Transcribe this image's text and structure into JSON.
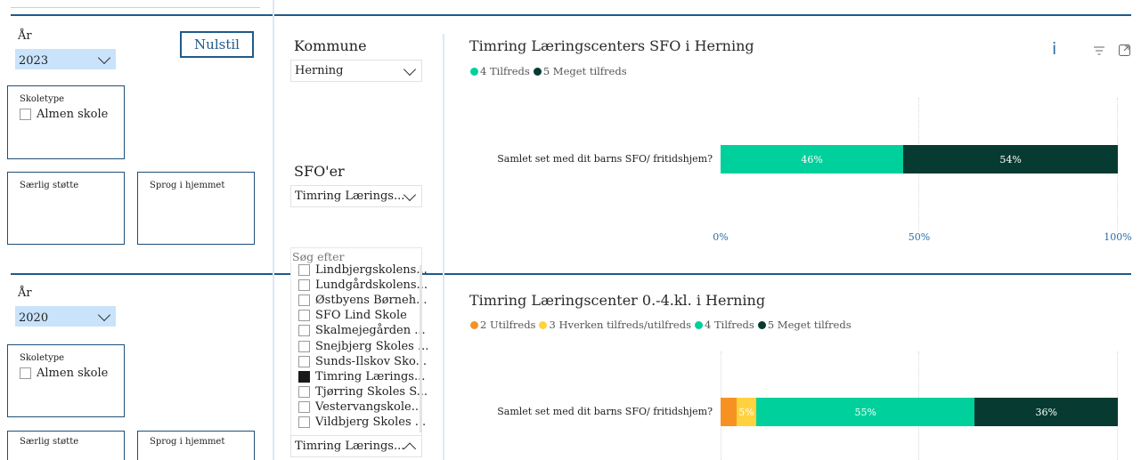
{
  "colors": {
    "accent": "#1f5a8a",
    "tilfreds": "#00d09b",
    "meget_tilfreds": "#073b32",
    "utilfreds": "#f79222",
    "hverken": "#ffd23f"
  },
  "top": {
    "year_label": "År",
    "year_value": "2023",
    "reset_label": "Nulstil",
    "school_type_title": "Skoletype",
    "school_type_option": "Almen skole",
    "special_support_title": "Særlig støtte",
    "home_language_title": "Sprog i hjemmet"
  },
  "bottom": {
    "year_label": "År",
    "year_value": "2020",
    "school_type_title": "Skoletype",
    "school_type_option": "Almen skole",
    "special_support_title": "Særlig støtte",
    "home_language_title": "Sprog i hjemmet"
  },
  "middle": {
    "kommune_label": "Kommune",
    "kommune_value": "Herning",
    "sfo_label": "SFO'er",
    "sfo_value": "Timring Lærings...",
    "search_placeholder": "Søg efter",
    "list": [
      {
        "label": "Lindbjergskolens...",
        "checked": false
      },
      {
        "label": "Lundgårdskolens...",
        "checked": false
      },
      {
        "label": "Østbyens Børneh...",
        "checked": false
      },
      {
        "label": "SFO Lind Skole",
        "checked": false
      },
      {
        "label": "Skalmejegården ...",
        "checked": false
      },
      {
        "label": "Snejbjerg Skoles ...",
        "checked": false
      },
      {
        "label": "Sunds-Ilskov Sko...",
        "checked": false
      },
      {
        "label": "Timring Lærings...",
        "checked": true
      },
      {
        "label": "Tjørring Skoles S...",
        "checked": false
      },
      {
        "label": "Vestervangskole...",
        "checked": false
      },
      {
        "label": "Vildbjerg Skoles ...",
        "checked": false
      }
    ],
    "bottom_dropdown_value": "Timring Lærings..."
  },
  "chart_data": [
    {
      "type": "bar",
      "orientation": "horizontal-stacked-100",
      "title": "Timring Læringscenters SFO i Herning",
      "categories": [
        "Samlet set med dit barns SFO/ fritidshjem?"
      ],
      "series": [
        {
          "name": "4 Tilfreds",
          "values": [
            46
          ],
          "label": "46%",
          "color": "#00d09b"
        },
        {
          "name": "5 Meget tilfreds",
          "values": [
            54
          ],
          "label": "54%",
          "color": "#073b32"
        }
      ],
      "xticks": [
        "0%",
        "50%",
        "100%"
      ],
      "xlim": [
        0,
        100
      ],
      "legend": "top-left"
    },
    {
      "type": "bar",
      "orientation": "horizontal-stacked-100",
      "title": "Timring Læringscenter 0.-4.kl. i Herning",
      "categories": [
        "Samlet set med dit barns SFO/ fritidshjem?"
      ],
      "series": [
        {
          "name": "2 Utilfreds",
          "values": [
            4
          ],
          "label": "",
          "color": "#f79222"
        },
        {
          "name": "3 Hverken tilfreds/utilfreds",
          "values": [
            5
          ],
          "label": "5%",
          "color": "#ffd23f"
        },
        {
          "name": "4 Tilfreds",
          "values": [
            55
          ],
          "label": "55%",
          "color": "#00d09b"
        },
        {
          "name": "5 Meget tilfreds",
          "values": [
            36
          ],
          "label": "36%",
          "color": "#073b32"
        }
      ],
      "xlim": [
        0,
        100
      ],
      "legend": "top-left"
    }
  ]
}
